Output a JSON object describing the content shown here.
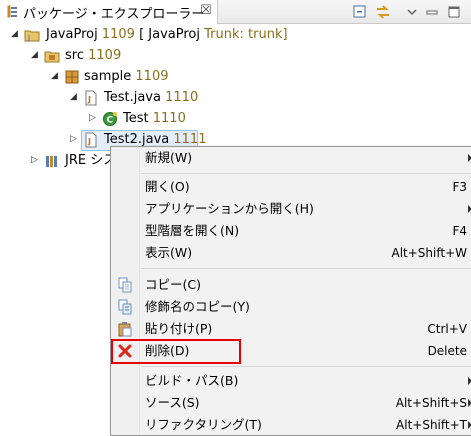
{
  "view": {
    "tab_title": "パッケージ・エクスプローラー",
    "tab_close": "☒"
  },
  "tree": {
    "project": {
      "name": "JavaProj",
      "rev": "1109",
      "deco": "[ JavaProj",
      "branch": "Trunk: trunk]"
    },
    "src": {
      "name": "src",
      "rev": "1109"
    },
    "package": {
      "name": "sample",
      "rev": "1109"
    },
    "file1": {
      "name": "Test.java",
      "rev": "1110"
    },
    "class1": {
      "name": "Test",
      "rev": "1110"
    },
    "file2": {
      "name": "Test2.java",
      "rev": "1111"
    },
    "jre": {
      "name": "JRE シス"
    }
  },
  "menu": {
    "new": {
      "label": "新規(W)"
    },
    "open": {
      "label": "開く(O)",
      "shortcut": "F3"
    },
    "open_with": {
      "label": "アプリケーションから開く(H)"
    },
    "open_hierarchy": {
      "label": "型階層を開く(N)",
      "shortcut": "F4"
    },
    "show": {
      "label": "表示(W)",
      "shortcut": "Alt+Shift+W"
    },
    "copy": {
      "label": "コピー(C)"
    },
    "copy_qualified": {
      "label": "修飾名のコピー(Y)"
    },
    "paste": {
      "label": "貼り付け(P)",
      "shortcut": "Ctrl+V"
    },
    "delete": {
      "label": "削除(D)",
      "shortcut": "Delete"
    },
    "build_path": {
      "label": "ビルド・パス(B)"
    },
    "source": {
      "label": "ソース(S)",
      "shortcut": "Alt+Shift+S"
    },
    "refactor": {
      "label": "リファクタリング(T)",
      "shortcut": "Alt+Shift+T"
    }
  },
  "colors": {
    "revision": "#8a6d1f",
    "selection": "#e4eefa",
    "delete_highlight": "#e60000"
  }
}
